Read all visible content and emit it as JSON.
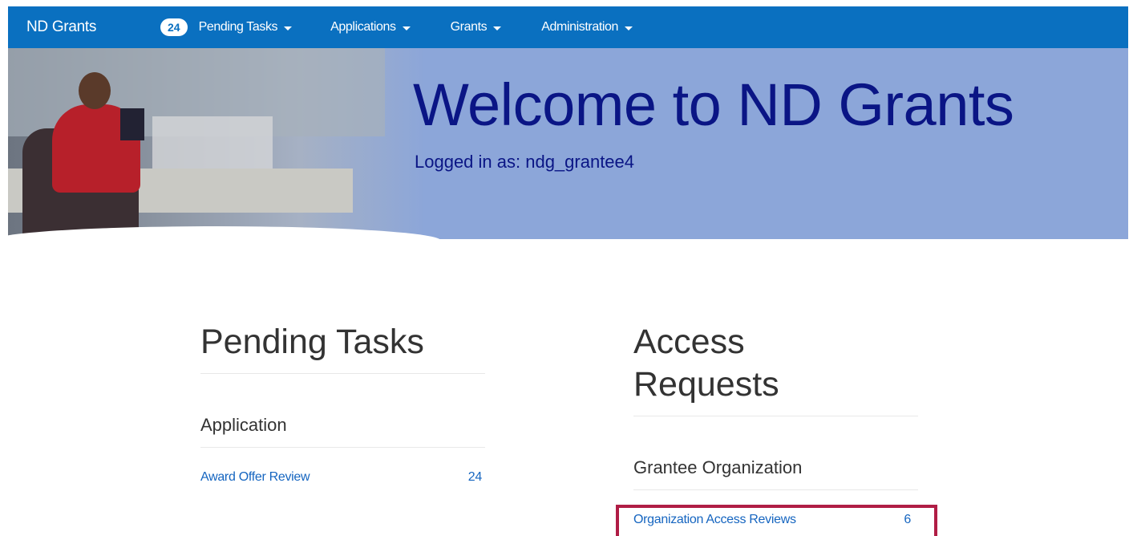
{
  "navbar": {
    "brand": "ND Grants",
    "badge_count": "24",
    "items": [
      {
        "label": "Pending Tasks"
      },
      {
        "label": "Applications"
      },
      {
        "label": "Grants"
      },
      {
        "label": "Administration"
      }
    ],
    "background_color": "#0a70c0"
  },
  "banner": {
    "title": "Welcome to ND Grants",
    "logged_in": "Logged in as: ndg_grantee4",
    "background_color": "#8ca6d9",
    "text_color": "#0a1585"
  },
  "pending_tasks": {
    "heading": "Pending Tasks",
    "group": "Application",
    "rows": [
      {
        "label": "Award Offer Review",
        "count": "24"
      }
    ]
  },
  "access_requests": {
    "heading_line1": "Access",
    "heading_line2": "Requests",
    "group": "Grantee Organization",
    "rows": [
      {
        "label": "Organization Access Reviews",
        "count": "6"
      }
    ],
    "highlight_color": "#b01d45"
  }
}
